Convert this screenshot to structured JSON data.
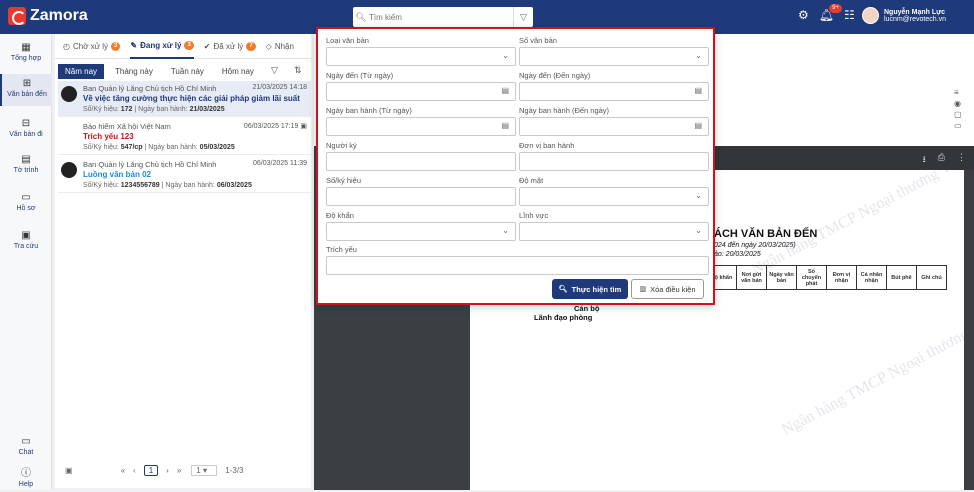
{
  "app": {
    "name": "Zamora"
  },
  "search": {
    "placeholder": "Tìm kiếm"
  },
  "user": {
    "name": "Nguyễn Mạnh Lực",
    "email": "lucnm@revotech.vn",
    "notif_badge": "9+"
  },
  "sidebar": {
    "items": [
      {
        "label": "Tổng hợp",
        "icon": "dashboard-icon"
      },
      {
        "label": "Văn bản đến",
        "icon": "inbox-icon"
      },
      {
        "label": "Văn bản đi",
        "icon": "outbox-icon"
      },
      {
        "label": "Tờ trình",
        "icon": "clipboard-icon"
      },
      {
        "label": "Hồ sơ",
        "icon": "folder-icon"
      },
      {
        "label": "Tra cứu",
        "icon": "search-book-icon"
      }
    ],
    "bottom": [
      {
        "label": "Chat",
        "icon": "chat-icon"
      },
      {
        "label": "Help",
        "icon": "help-icon"
      }
    ]
  },
  "tabs": [
    {
      "label": "Chờ xử lý",
      "count": "3"
    },
    {
      "label": "Đang xử lý",
      "count": "3"
    },
    {
      "label": "Đã xử lý",
      "count": "7"
    },
    {
      "label": "Nhận",
      "count": ""
    }
  ],
  "periods": [
    "Năm nay",
    "Tháng này",
    "Tuần này",
    "Hôm nay"
  ],
  "documents": [
    {
      "org": "Ban Quản lý Lăng Chủ tịch Hồ Chí Minh",
      "time": "21/03/2025 14:18",
      "title": "Về việc tăng cường thực hiện các giải pháp giảm lãi suất",
      "title_color": "#1f3a7a",
      "meta_num_label": "Số/Ký hiệu:",
      "meta_num": "172",
      "meta_date_label": "| Ngày ban hành:",
      "meta_date": "21/03/2025"
    },
    {
      "org": "Bảo hiểm Xã hội Việt Nam",
      "time": "06/03/2025 17:19",
      "title": "Trích yếu 123",
      "title_color": "#d0121b",
      "meta_num_label": "Số/Ký hiệu:",
      "meta_num": "547/cp",
      "meta_date_label": "| Ngày ban hành:",
      "meta_date": "05/03/2025"
    },
    {
      "org": "Ban Quản lý Lăng Chủ tịch Hồ Chí Minh",
      "time": "06/03/2025 11:39",
      "title": "Luồng văn bản 02",
      "title_color": "#1e88e5",
      "meta_num_label": "Số/Ký hiệu:",
      "meta_num": "1234556789",
      "meta_date_label": "| Ngày ban hành:",
      "meta_date": "06/03/2025"
    }
  ],
  "pager": {
    "current": "1",
    "per_page": "1",
    "range": "1-3/3"
  },
  "filter": {
    "fields": [
      {
        "label": "Loại văn bản",
        "type": "select"
      },
      {
        "label": "Số văn bản",
        "type": "select"
      },
      {
        "label": "Ngày đến (Từ ngày)",
        "type": "date"
      },
      {
        "label": "Ngày đến (Đến ngày)",
        "type": "date"
      },
      {
        "label": "Ngày ban hành (Từ ngày)",
        "type": "date"
      },
      {
        "label": "Ngày ban hành (Đến ngày)",
        "type": "date"
      },
      {
        "label": "Người ký",
        "type": "text"
      },
      {
        "label": "Đơn vị ban hành",
        "type": "text"
      },
      {
        "label": "Số/ký hiệu",
        "type": "text"
      },
      {
        "label": "Độ mật",
        "type": "select"
      },
      {
        "label": "Độ khẩn",
        "type": "select"
      },
      {
        "label": "Lĩnh vực",
        "type": "select"
      }
    ],
    "summary_label": "Trích yếu",
    "search_button": "Thực hiện tìm",
    "clear_button": "Xóa điều kiện"
  },
  "report": {
    "title": "ÁCH VĂN BẢN ĐẾN",
    "subtitle1": "024 đến ngày 20/03/2025)",
    "subtitle2": "ảo: 20/03/2025",
    "columns": [
      "Độ khẩn",
      "Nơi gửi văn bản",
      "Ngày văn bản",
      "Số chuyển phát",
      "Đơn vị nhận",
      "Cá nhân nhận",
      "Bút phê",
      "Ghi chú"
    ],
    "sign_title": "Cán bộ",
    "sign_subtitle": "Lãnh đạo phòng",
    "watermark": "Ngân hàng TMCP Ngoại thương V"
  },
  "colors": {
    "brand": "#1f3a7a",
    "highlight": "#d0121b",
    "badge": "#f07c2a"
  }
}
